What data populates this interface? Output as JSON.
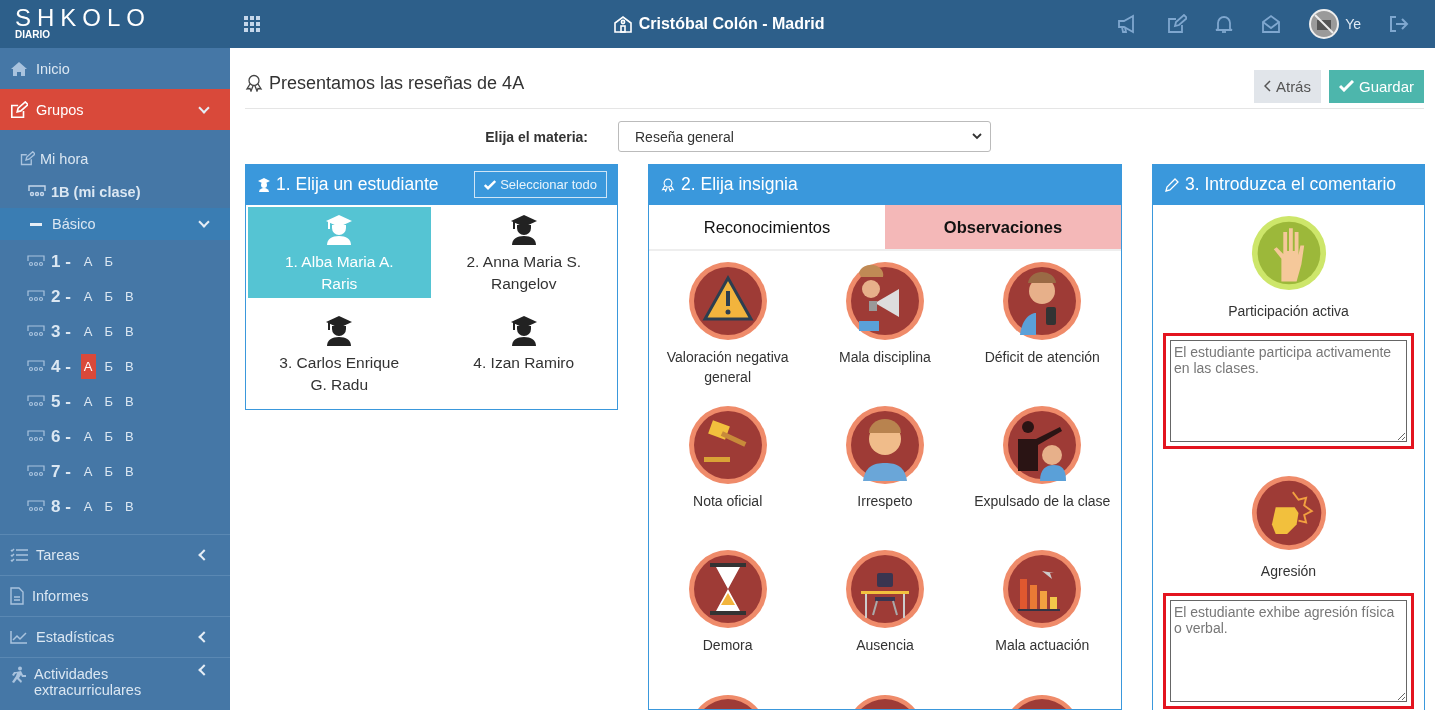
{
  "app": {
    "logo": "SHKOLO",
    "logo_sub": "DIARIO"
  },
  "header": {
    "school": "Cristóbal Colón - Madrid",
    "user": "Ye"
  },
  "sidebar": {
    "top": [
      {
        "label": "Inicio",
        "kind": "link",
        "selected": false
      },
      {
        "label": "Grupos",
        "kind": "group",
        "selected": true,
        "expanded": true
      }
    ],
    "sub": [
      {
        "label": "Mi hora",
        "bold": false
      },
      {
        "label": "1B (mi clase)",
        "bold": true
      }
    ],
    "level": {
      "label": "Básico",
      "expanded": true
    },
    "grades": [
      {
        "number": "1 -",
        "sections": [
          {
            "label": "А",
            "selected": false
          },
          {
            "label": "Б",
            "selected": false
          }
        ]
      },
      {
        "number": "2 -",
        "sections": [
          {
            "label": "А",
            "selected": false
          },
          {
            "label": "Б",
            "selected": false
          },
          {
            "label": "В",
            "selected": false
          }
        ]
      },
      {
        "number": "3 -",
        "sections": [
          {
            "label": "А",
            "selected": false
          },
          {
            "label": "Б",
            "selected": false
          },
          {
            "label": "В",
            "selected": false
          }
        ]
      },
      {
        "number": "4 -",
        "sections": [
          {
            "label": "А",
            "selected": true
          },
          {
            "label": "Б",
            "selected": false
          },
          {
            "label": "В",
            "selected": false
          }
        ]
      },
      {
        "number": "5 -",
        "sections": [
          {
            "label": "А",
            "selected": false
          },
          {
            "label": "Б",
            "selected": false
          },
          {
            "label": "В",
            "selected": false
          }
        ]
      },
      {
        "number": "6 -",
        "sections": [
          {
            "label": "А",
            "selected": false
          },
          {
            "label": "Б",
            "selected": false
          },
          {
            "label": "В",
            "selected": false
          }
        ]
      },
      {
        "number": "7 -",
        "sections": [
          {
            "label": "А",
            "selected": false
          },
          {
            "label": "Б",
            "selected": false
          },
          {
            "label": "В",
            "selected": false
          }
        ]
      },
      {
        "number": "8 -",
        "sections": [
          {
            "label": "А",
            "selected": false
          },
          {
            "label": "Б",
            "selected": false
          },
          {
            "label": "В",
            "selected": false
          }
        ]
      }
    ],
    "bottom": [
      {
        "label": "Tareas",
        "kind": "group",
        "expanded": false
      },
      {
        "label": "Informes",
        "kind": "link"
      },
      {
        "label": "Estadísticas",
        "kind": "group",
        "expanded": false
      },
      {
        "label": "Actividades extracurriculares",
        "kind": "group",
        "expanded": false
      }
    ]
  },
  "page": {
    "title": "Presentamos las reseñas de 4A",
    "back": "Atrás",
    "save": "Guardar"
  },
  "subject": {
    "label": "Elija el materia:",
    "value": "Reseña general"
  },
  "students": {
    "title": "1. Elija un estudiante",
    "select_all": "Seleccionar todo",
    "items": [
      {
        "name": "1. Alba Maria A. Raris",
        "selected": true
      },
      {
        "name": "2. Anna Maria S. Rangelov",
        "selected": false
      },
      {
        "name": "3. Carlos Enrique G. Radu",
        "selected": false
      },
      {
        "name": "4. Izan Ramiro",
        "selected": false
      }
    ]
  },
  "badges": {
    "title": "2. Elija insignia",
    "tabs": [
      {
        "label": "Reconocimientos",
        "selected": false
      },
      {
        "label": "Observaciones",
        "selected": true
      }
    ],
    "items": [
      {
        "label": "Valoración negativa general"
      },
      {
        "label": "Mala disciplina"
      },
      {
        "label": "Déficit de atención"
      },
      {
        "label": "Nota oficial"
      },
      {
        "label": "Irrespeto"
      },
      {
        "label": "Expulsado de la clase"
      },
      {
        "label": "Demora"
      },
      {
        "label": "Ausencia"
      },
      {
        "label": "Mala actuación"
      }
    ]
  },
  "comments": {
    "title": "3. Introduzca el comentario",
    "items": [
      {
        "label": "Participación activa",
        "placeholder": "El estudiante participa activamente en las clases.",
        "error": true
      },
      {
        "label": "Agresión",
        "placeholder": "El estudiante exhibe agresión física o verbal.",
        "error": true
      }
    ]
  }
}
